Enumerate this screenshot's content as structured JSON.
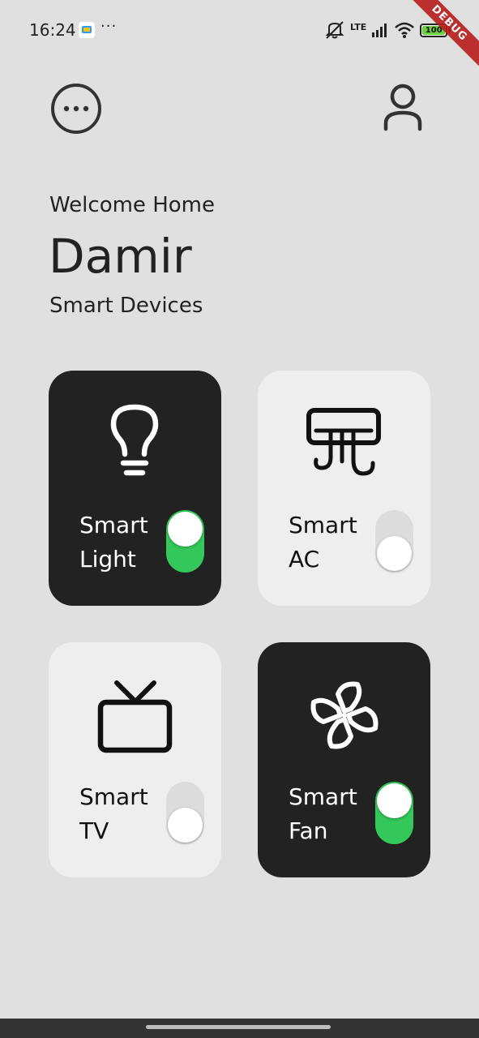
{
  "status_bar": {
    "time": "16:24",
    "more": "···",
    "network": "LTE",
    "battery": "100"
  },
  "debug_banner": "DEBUG",
  "header": {
    "menu_icon": "more-horizontal-circle-icon",
    "profile_icon": "person-icon"
  },
  "greeting": {
    "welcome": "Welcome Home",
    "name": "Damir",
    "section_title": "Smart Devices"
  },
  "devices": [
    {
      "label": "Smart\nLight",
      "icon": "lightbulb-icon",
      "on": true
    },
    {
      "label": "Smart\nAC",
      "icon": "air-conditioner-icon",
      "on": false
    },
    {
      "label": "Smart\nTV",
      "icon": "tv-icon",
      "on": false
    },
    {
      "label": "Smart\nFan",
      "icon": "fan-icon",
      "on": true
    }
  ],
  "colors": {
    "background": "#e0e0e0",
    "card_on": "#222222",
    "card_off": "#eeeeee",
    "toggle_on": "#34c759",
    "toggle_off": "#dcdcdc",
    "debug_ribbon": "#b71c1c"
  }
}
